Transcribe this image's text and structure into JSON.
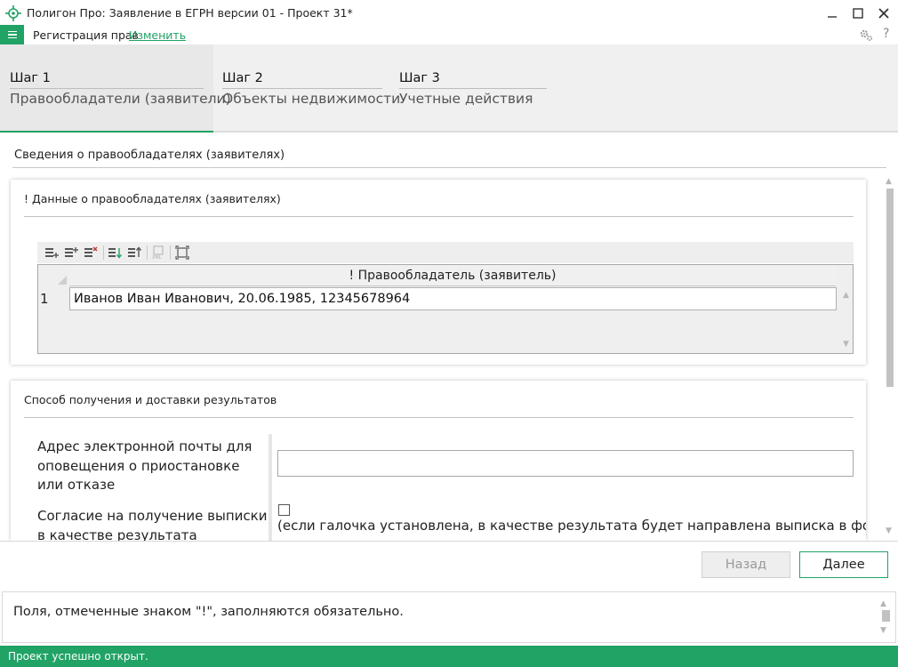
{
  "window": {
    "title": "Полигон Про: Заявление в ЕГРН версии 01 - Проект 31*",
    "controls": {
      "minimize_icon": "minimize-icon",
      "maximize_icon": "maximize-icon",
      "close_icon": "close-icon"
    }
  },
  "menubar": {
    "menu_icon": "hamburger-menu-icon",
    "registration_label": "Регистрация прав",
    "change_link": "Изменить",
    "settings_icon": "settings-icon",
    "help_label": "?"
  },
  "steps": [
    {
      "title": "Шаг 1",
      "subtitle": "Правообладатели (заявители)",
      "active": true
    },
    {
      "title": "Шаг 2",
      "subtitle": "Объекты недвижимости",
      "active": false
    },
    {
      "title": "Шаг 3",
      "subtitle": "Учетные действия",
      "active": false
    }
  ],
  "main": {
    "section_heading": "Сведения о правообладателях (заявителях)",
    "holders_panel": {
      "title": "! Данные о правообладателях (заявителях)",
      "toolbar_icons": [
        "add-row-icon",
        "insert-row-icon",
        "delete-row-icon",
        "move-down-icon",
        "move-up-icon",
        "import-xml-icon",
        "expand-icon"
      ],
      "grid": {
        "column_header": "! Правообладатель (заявитель)",
        "rows": [
          {
            "number": "1",
            "value": "Иванов Иван Иванович, 20.06.1985, 12345678964"
          }
        ]
      }
    },
    "delivery_panel": {
      "title": "Способ получения и доставки результатов",
      "email_label": "Адрес электронной почты для оповещения о приостановке или отказе",
      "email_value": "",
      "consent_label": "Согласие на получение выписки в качестве результата",
      "consent_checked": false,
      "consent_note": "(если галочка установлена, в качестве результата будет направлена выписка в форме"
    }
  },
  "buttons": {
    "back": "Назад",
    "next": "Далее"
  },
  "info": {
    "message": "Поля, отмеченные знаком \"!\", заполняются обязательно."
  },
  "status": {
    "message": "Проект успешно открыт."
  },
  "colors": {
    "accent": "#21a366",
    "panel_bg": "#f0f0f0"
  }
}
